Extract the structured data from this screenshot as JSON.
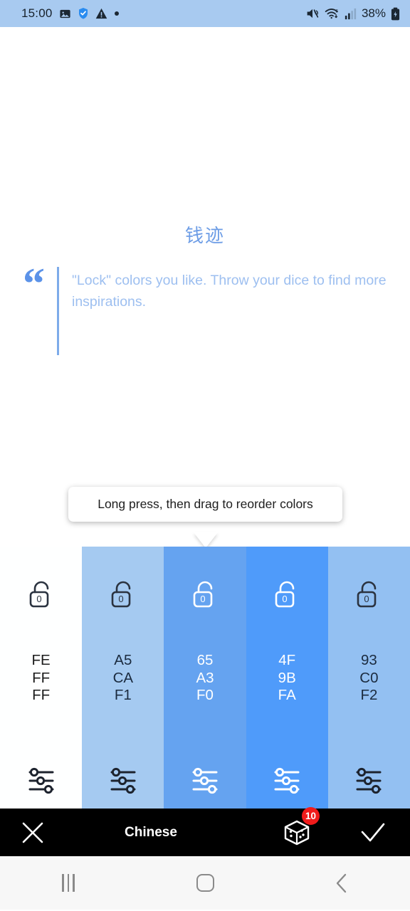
{
  "statusbar": {
    "time": "15:00",
    "battery_text": "38%",
    "icons": [
      "image-icon",
      "shield-check-icon",
      "warning-icon",
      "dot-icon",
      "mute-icon",
      "wifi-icon",
      "signal-icon",
      "battery-charging-icon"
    ]
  },
  "app": {
    "title": "钱迹",
    "title_color": "#6d9de6",
    "quote": "\"Lock\" colors you like. Throw your dice to find more inspirations.",
    "quote_color": "#9dbff0"
  },
  "tooltip": {
    "text": "Long press, then drag to reorder colors"
  },
  "palette": {
    "columns": [
      {
        "hex": "FEFFFF",
        "background": "#FEFFFF",
        "hex1": "FE",
        "hex2": "FF",
        "hex3": "FF",
        "text_color": "#1b1b1b",
        "locked": false
      },
      {
        "hex": "A5CAF1",
        "background": "#A5CAF1",
        "hex1": "A5",
        "hex2": "CA",
        "hex3": "F1",
        "text_color": "#1b2b3f",
        "locked": false
      },
      {
        "hex": "65A3F0",
        "background": "#65A3F0",
        "hex1": "65",
        "hex2": "A3",
        "hex3": "F0",
        "text_color": "#ffffff",
        "locked": false
      },
      {
        "hex": "4F9BFA",
        "background": "#4F9BFA",
        "hex1": "4F",
        "hex2": "9B",
        "hex3": "FA",
        "text_color": "#ffffff",
        "locked": false
      },
      {
        "hex": "93C0F2",
        "background": "#93C0F2",
        "hex1": "93",
        "hex2": "C0",
        "hex3": "F2",
        "text_color": "#1b2b3f",
        "locked": false
      }
    ],
    "lock_label": "0"
  },
  "bottombar": {
    "close_label": "close-icon",
    "title": "Chinese",
    "dice_badge": "10",
    "confirm_label": "check-icon"
  },
  "navbar": {
    "recents": "recents-icon",
    "home": "home-icon",
    "back": "back-icon"
  }
}
